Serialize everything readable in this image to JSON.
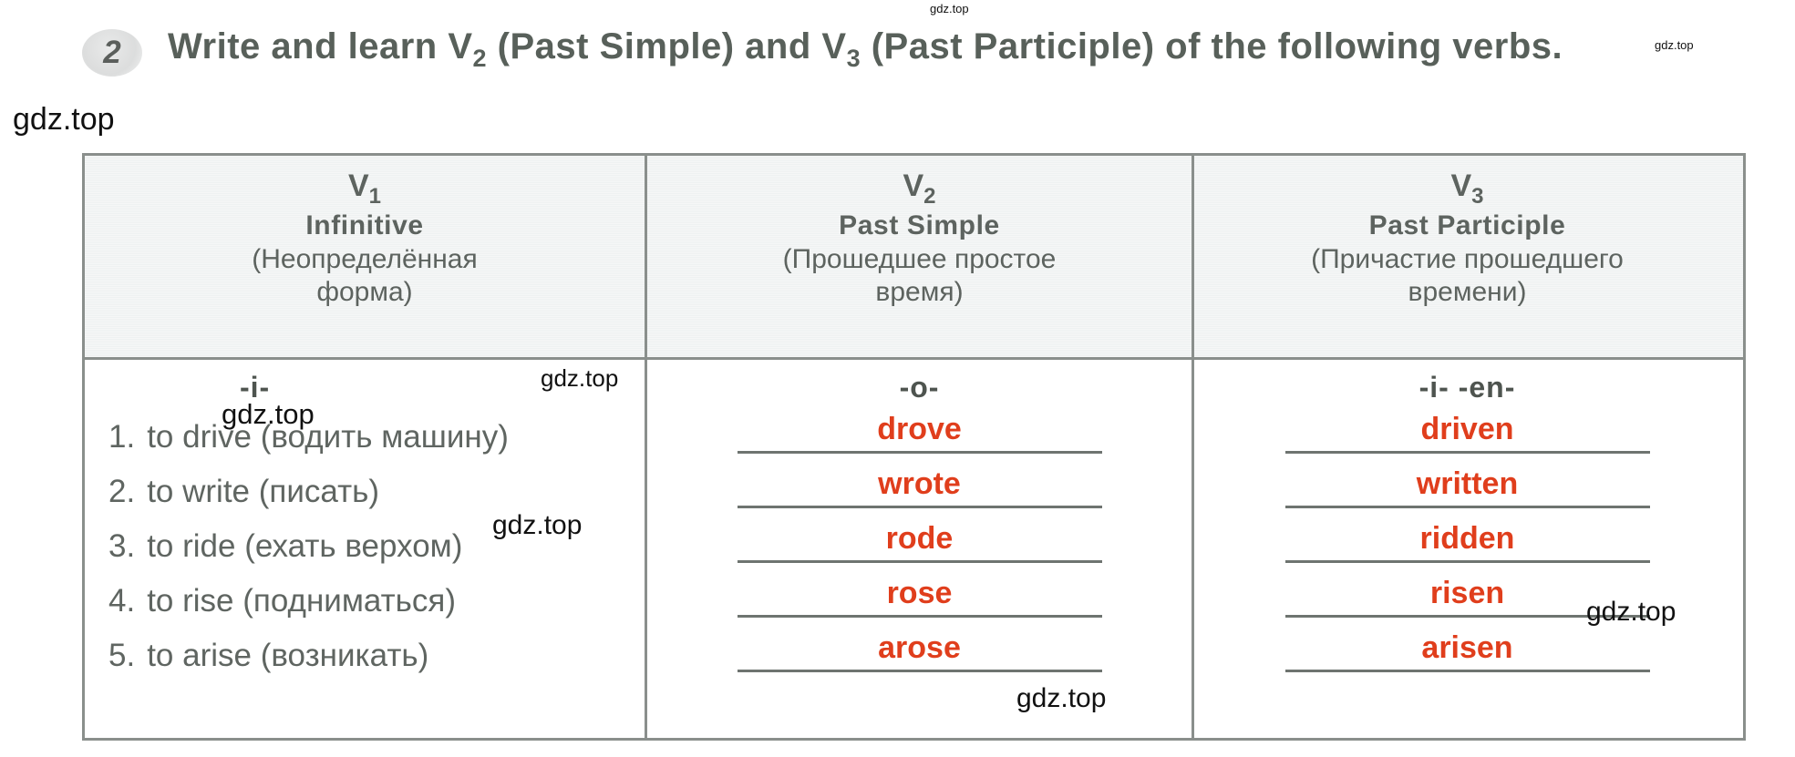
{
  "task": {
    "number": "2",
    "instruction_parts": [
      {
        "t": "Write  and  learn  V"
      },
      {
        "sub": "2"
      },
      {
        "t": "  (Past  Simple)  and  V"
      },
      {
        "sub": "3"
      },
      {
        "t": "  (Past  Participle)  of  the  following  verbs."
      }
    ],
    "instruction_plain": "Write and learn V2 (Past Simple) and V3 (Past Participle) of the following verbs."
  },
  "table": {
    "headers": [
      {
        "v_label": "V",
        "v_index": "1",
        "en": "Infinitive",
        "ru": "(Неопределённая\nформа)"
      },
      {
        "v_label": "V",
        "v_index": "2",
        "en": "Past  Simple",
        "ru": "(Прошедшее простое\nвремя)"
      },
      {
        "v_label": "V",
        "v_index": "3",
        "en": "Past  Participle",
        "ru": "(Причастие прошедшего\nвремени)"
      }
    ],
    "markers": [
      "-i-",
      "-o-",
      "-i-  -en-"
    ],
    "rows": [
      {
        "num": "1.",
        "infinitive": "to drive (водить машину)",
        "past_simple": "drove",
        "past_participle": "driven"
      },
      {
        "num": "2.",
        "infinitive": "to write  (писать)",
        "past_simple": "wrote",
        "past_participle": "written"
      },
      {
        "num": "3.",
        "infinitive": "to ride  (ехать  верхом)",
        "past_simple": "rode",
        "past_participle": "ridden"
      },
      {
        "num": "4.",
        "infinitive": "to rise  (подниматься)",
        "past_simple": "rose",
        "past_participle": "risen"
      },
      {
        "num": "5.",
        "infinitive": "to arise  (возникать)",
        "past_simple": "arose",
        "past_participle": "arisen"
      }
    ]
  },
  "watermarks": {
    "text": "gdz.top",
    "instances": [
      {
        "id": "top-center"
      },
      {
        "id": "left-margin"
      },
      {
        "id": "top-right-corner"
      },
      {
        "id": "col1-a"
      },
      {
        "id": "col1-b"
      },
      {
        "id": "col1-c"
      },
      {
        "id": "col2-bottom"
      },
      {
        "id": "col3-right"
      }
    ]
  },
  "colors": {
    "answer_red": "#e03e1c",
    "text_gray": "#5f6561",
    "header_bg": "#eef1f1",
    "border": "#8a8f8c"
  }
}
